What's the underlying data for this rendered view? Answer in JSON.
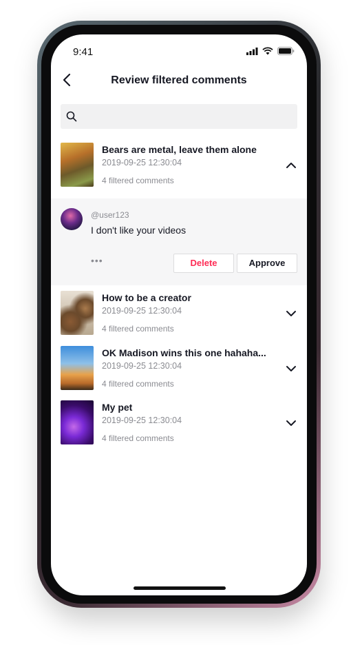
{
  "status": {
    "time": "9:41"
  },
  "nav": {
    "title": "Review filtered comments"
  },
  "search": {
    "placeholder": ""
  },
  "videos": [
    {
      "title": "Bears are metal, leave them alone",
      "date": "2019-09-25 12:30:04",
      "count": "4 filtered comments",
      "expanded": true,
      "thumb_colors": [
        "#c9a33a",
        "#7a4a1c"
      ]
    },
    {
      "title": "How to be a creator",
      "date": "2019-09-25 12:30:04",
      "count": "4 filtered comments",
      "expanded": false,
      "thumb_colors": [
        "#d9cdbd",
        "#6b4a2c"
      ]
    },
    {
      "title": "OK Madison wins this one hahaha...",
      "date": "2019-09-25 12:30:04",
      "count": "4 filtered comments",
      "expanded": false,
      "thumb_colors": [
        "#4a8ed6",
        "#d98a3a"
      ]
    },
    {
      "title": "My pet",
      "date": "2019-09-25 12:30:04",
      "count": "4 filtered comments",
      "expanded": false,
      "thumb_colors": [
        "#7a2ad6",
        "#2a0c4a"
      ]
    }
  ],
  "comment": {
    "user": "@user123",
    "text": "I don't like your videos",
    "more": "•••"
  },
  "actions": {
    "delete": "Delete",
    "approve": "Approve"
  },
  "colors": {
    "accent": "#fe2c55",
    "text": "#161823",
    "muted": "#8a8b91"
  }
}
